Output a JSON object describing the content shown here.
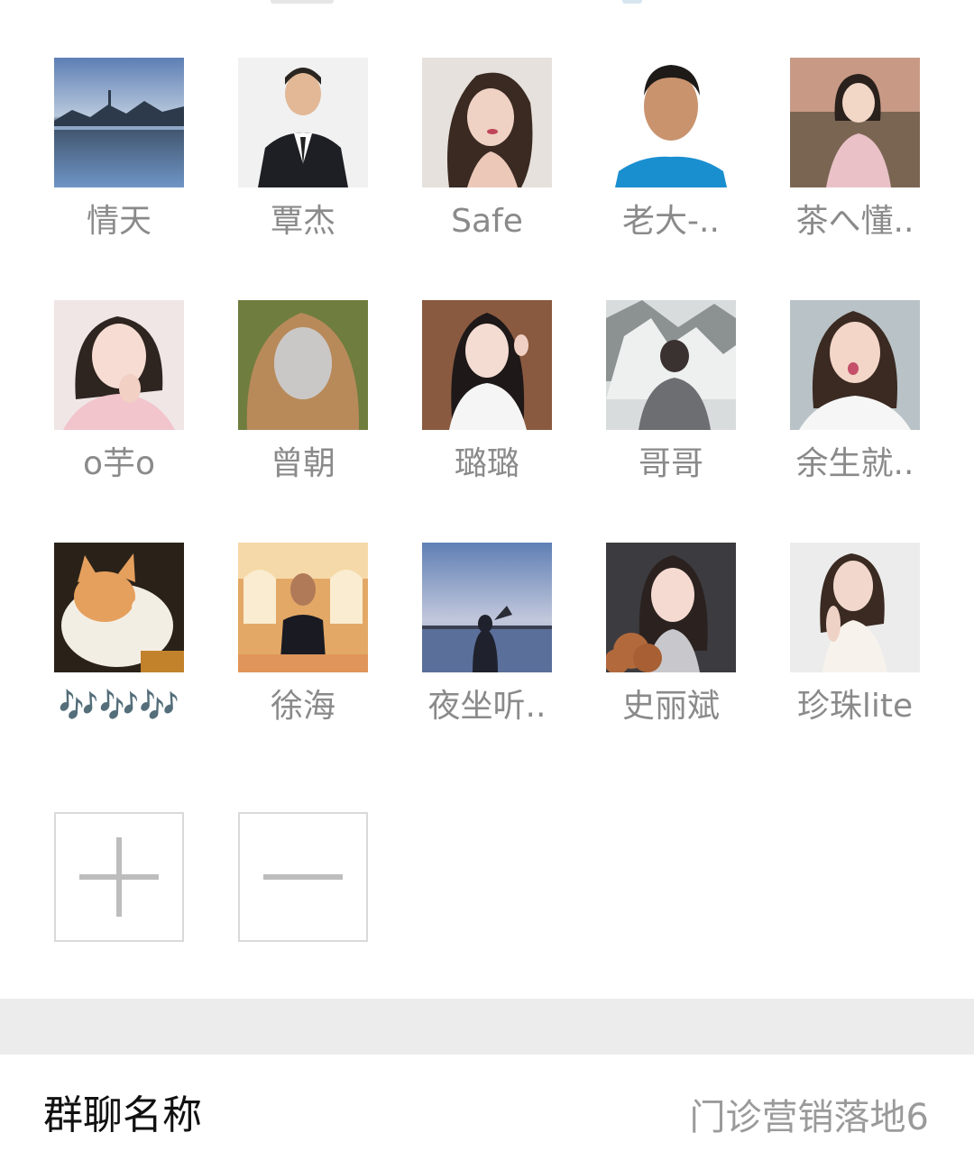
{
  "members": [
    {
      "name": "情天",
      "avatar": "landscape-lake-avatar"
    },
    {
      "name": "覃杰",
      "avatar": "man-suit-avatar"
    },
    {
      "name": "Safe",
      "avatar": "woman-portrait-avatar"
    },
    {
      "name": "老大-..",
      "avatar": "man-blue-shirt-avatar"
    },
    {
      "name": "茶へ懂..",
      "avatar": "woman-sofa-avatar"
    },
    {
      "name": "o芋o",
      "avatar": "woman-hand-chin-avatar"
    },
    {
      "name": "曾朝",
      "avatar": "woman-blonde-avatar"
    },
    {
      "name": "璐璐",
      "avatar": "woman-peace-sign-avatar"
    },
    {
      "name": "哥哥",
      "avatar": "man-snow-mountain-avatar"
    },
    {
      "name": "余生就..",
      "avatar": "woman-kiss-face-avatar"
    },
    {
      "name": "🎶🎶🎶",
      "avatar": "cat-avatar"
    },
    {
      "name": "徐海",
      "avatar": "man-banquet-hall-avatar"
    },
    {
      "name": "夜坐听..",
      "avatar": "lake-heart-hands-avatar"
    },
    {
      "name": "史丽斌",
      "avatar": "woman-puppy-avatar"
    },
    {
      "name": "珍珠lite",
      "avatar": "woman-white-dress-avatar"
    }
  ],
  "actions": {
    "add": "plus-icon",
    "remove": "minus-icon"
  },
  "group_name_row": {
    "label": "群聊名称",
    "value": "门诊营销落地6"
  }
}
